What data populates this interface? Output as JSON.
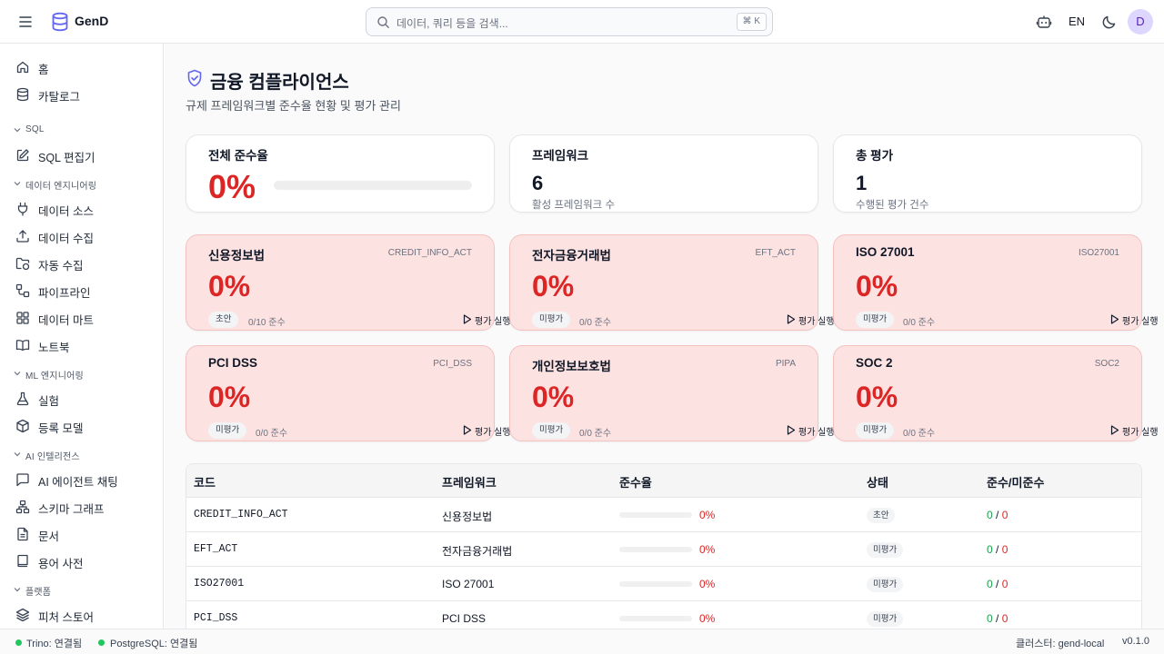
{
  "app": {
    "brand": "GenD"
  },
  "header": {
    "search_placeholder": "데이터, 쿼리 등을 검색...",
    "search_shortcut": "⌘ K",
    "lang": "EN",
    "avatar_initial": "D"
  },
  "sidebar": {
    "items": [
      {
        "label": "홈",
        "icon": "home-icon"
      },
      {
        "label": "카탈로그",
        "icon": "database-icon"
      },
      {
        "label": "SQL 편집기",
        "icon": "edit-icon"
      },
      {
        "label": "데이터 소스",
        "icon": "plug-icon"
      },
      {
        "label": "데이터 수집",
        "icon": "upload-icon"
      },
      {
        "label": "자동 수집",
        "icon": "folder-sync-icon"
      },
      {
        "label": "파이프라인",
        "icon": "workflow-icon"
      },
      {
        "label": "데이터 마트",
        "icon": "grid-icon"
      },
      {
        "label": "노트북",
        "icon": "book-icon"
      },
      {
        "label": "실험",
        "icon": "flask-icon"
      },
      {
        "label": "등록 모델",
        "icon": "box-icon"
      },
      {
        "label": "AI 에이전트 채팅",
        "icon": "chat-icon"
      },
      {
        "label": "스키마 그래프",
        "icon": "network-icon"
      },
      {
        "label": "문서",
        "icon": "document-icon"
      },
      {
        "label": "용어 사전",
        "icon": "book-open-icon"
      },
      {
        "label": "피처 스토어",
        "icon": "layers-icon"
      }
    ],
    "sections": [
      "SQL",
      "데이터 엔지니어링",
      "ML 엔지니어링",
      "AI 인텔리전스",
      "플랫폼"
    ]
  },
  "page": {
    "title": "금융 컴플라이언스",
    "subtitle": "규제 프레임워크별 준수율 현황 및 평가 관리"
  },
  "summary": {
    "overall": {
      "label": "전체 준수율",
      "value": "0%",
      "progress": 0
    },
    "frameworks": {
      "label": "프레임워크",
      "value": "6",
      "note": "활성 프레임워크 수"
    },
    "assessments": {
      "label": "총 평가",
      "value": "1",
      "note": "수행된 평가 건수"
    }
  },
  "framework_cards": [
    {
      "name": "신용정보법",
      "code": "CREDIT_INFO_ACT",
      "rate": "0%",
      "status": "초안",
      "count": "0/10 준수",
      "action": "평가 실행"
    },
    {
      "name": "전자금융거래법",
      "code": "EFT_ACT",
      "rate": "0%",
      "status": "미평가",
      "count": "0/0 준수",
      "action": "평가 실행"
    },
    {
      "name": "ISO 27001",
      "code": "ISO27001",
      "rate": "0%",
      "status": "미평가",
      "count": "0/0 준수",
      "action": "평가 실행"
    },
    {
      "name": "PCI DSS",
      "code": "PCI_DSS",
      "rate": "0%",
      "status": "미평가",
      "count": "0/0 준수",
      "action": "평가 실행"
    },
    {
      "name": "개인정보보호법",
      "code": "PIPA",
      "rate": "0%",
      "status": "미평가",
      "count": "0/0 준수",
      "action": "평가 실행"
    },
    {
      "name": "SOC 2",
      "code": "SOC2",
      "rate": "0%",
      "status": "미평가",
      "count": "0/0 준수",
      "action": "평가 실행"
    }
  ],
  "table": {
    "headers": [
      "코드",
      "프레임워크",
      "준수율",
      "상태",
      "준수/미준수"
    ],
    "separator": "/",
    "rows": [
      {
        "code": "CREDIT_INFO_ACT",
        "framework": "신용정보법",
        "rate": "0%",
        "status": "초안",
        "compliant": "0",
        "noncompliant": "0"
      },
      {
        "code": "EFT_ACT",
        "framework": "전자금융거래법",
        "rate": "0%",
        "status": "미평가",
        "compliant": "0",
        "noncompliant": "0"
      },
      {
        "code": "ISO27001",
        "framework": "ISO 27001",
        "rate": "0%",
        "status": "미평가",
        "compliant": "0",
        "noncompliant": "0"
      },
      {
        "code": "PCI_DSS",
        "framework": "PCI DSS",
        "rate": "0%",
        "status": "미평가",
        "compliant": "0",
        "noncompliant": "0"
      }
    ]
  },
  "statusbar": {
    "trino": "Trino: 연결됨",
    "postgres": "PostgreSQL: 연결됨",
    "cluster": "클러스터: gend-local",
    "version": "v0.1.0"
  },
  "colors": {
    "accent": "#6366f1",
    "danger": "#dc2626",
    "success": "#16a34a",
    "card_alert_bg": "#fde2e2"
  }
}
